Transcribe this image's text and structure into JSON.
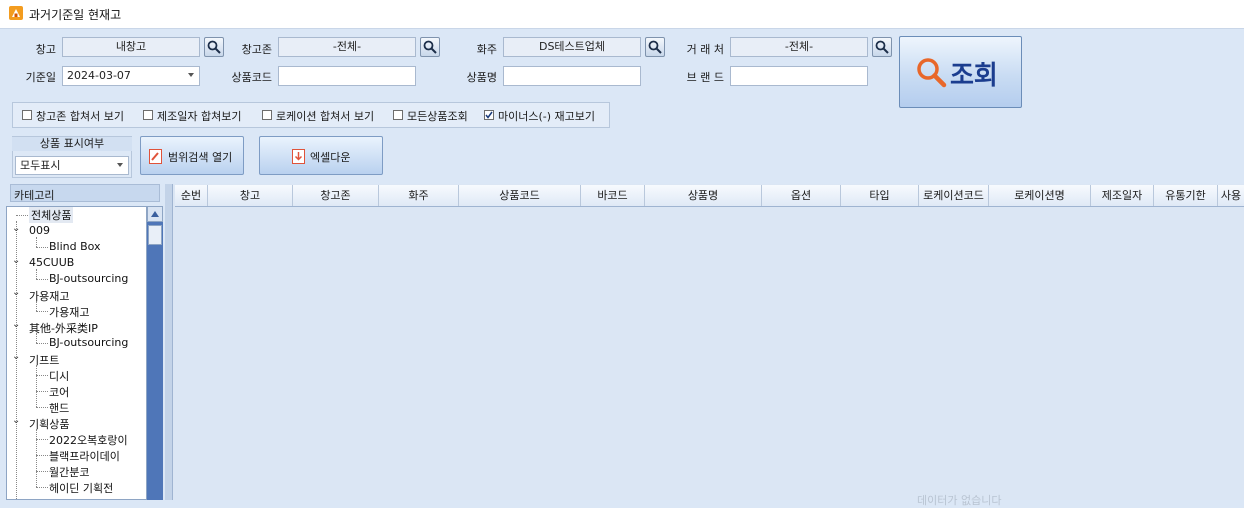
{
  "window": {
    "title": "과거기준일 현재고"
  },
  "filters": {
    "warehouse": {
      "label": "창고",
      "value": "내창고"
    },
    "zone": {
      "label": "창고존",
      "value": "-전체-"
    },
    "owner": {
      "label": "화주",
      "value": "DS테스트업체"
    },
    "partner": {
      "label": "거 래 처",
      "value": "-전체-"
    },
    "base_date": {
      "label": "기준일",
      "value": "2024-03-07"
    },
    "product_code": {
      "label": "상품코드",
      "value": ""
    },
    "product_name": {
      "label": "상품명",
      "value": ""
    },
    "brand": {
      "label": "브 랜 드",
      "value": ""
    }
  },
  "search_button": {
    "label": "조회"
  },
  "options": [
    {
      "label": "창고존 합쳐서 보기",
      "checked": false
    },
    {
      "label": "제조일자 합쳐보기",
      "checked": false
    },
    {
      "label": "로케이션 합쳐서 보기",
      "checked": false
    },
    {
      "label": "모든상품조회",
      "checked": false
    },
    {
      "label": "마이너스(-) 재고보기",
      "checked": true
    }
  ],
  "display_group": {
    "title": "상품 표시여부",
    "value": "모두표시"
  },
  "actions": {
    "range_search": "범위검색 열기",
    "excel": "엑셀다운"
  },
  "category": {
    "header": "카테고리",
    "items": [
      {
        "label": "전체상품",
        "level": 0,
        "selected": true
      },
      {
        "label": "009",
        "level": 0,
        "expanded": true
      },
      {
        "label": "Blind Box",
        "level": 1
      },
      {
        "label": "45CUUB",
        "level": 0,
        "expanded": true
      },
      {
        "label": "BJ-outsourcing",
        "level": 1
      },
      {
        "label": "가용재고",
        "level": 0,
        "expanded": true
      },
      {
        "label": "가용재고",
        "level": 1
      },
      {
        "label": "其他-外采类IP",
        "level": 0,
        "expanded": true
      },
      {
        "label": "BJ-outsourcing",
        "level": 1
      },
      {
        "label": "기프트",
        "level": 0,
        "expanded": true
      },
      {
        "label": "디시",
        "level": 1
      },
      {
        "label": "코어",
        "level": 1
      },
      {
        "label": "핸드",
        "level": 1
      },
      {
        "label": "기획상품",
        "level": 0,
        "expanded": true
      },
      {
        "label": "2022오복호랑이",
        "level": 1
      },
      {
        "label": "블랙프라이데이",
        "level": 1
      },
      {
        "label": "월간분코",
        "level": 1
      },
      {
        "label": "헤이딘 기획전",
        "level": 1
      }
    ]
  },
  "grid": {
    "columns": [
      "순번",
      "창고",
      "창고존",
      "화주",
      "상품코드",
      "바코드",
      "상품명",
      "옵션",
      "타입",
      "로케이션코드",
      "로케이션명",
      "제조일자",
      "유통기한",
      "사용"
    ],
    "empty_message": "데이터가 없습니다"
  }
}
